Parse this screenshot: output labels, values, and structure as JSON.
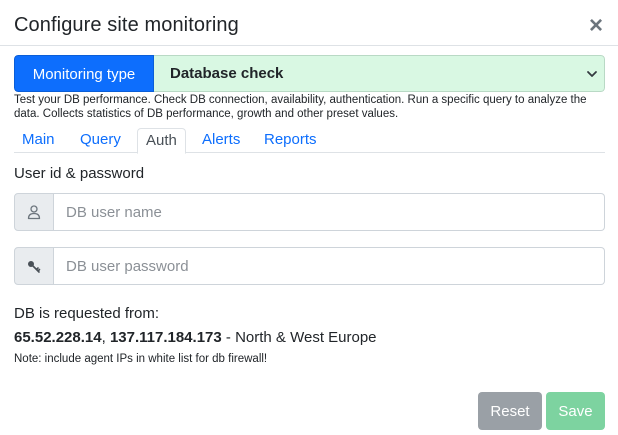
{
  "dialog": {
    "title": "Configure site monitoring",
    "close_symbol": "×"
  },
  "monitoring_type": {
    "label": "Monitoring type",
    "selected": "Database check",
    "icon": "chevron-down-icon"
  },
  "description": "Test your DB performance. Check DB connection, availability, authentication. Run a specific query to analyze the data. Collects statistics of DB performance, growth and other preset values.",
  "tabs": [
    {
      "label": "Main",
      "active": false
    },
    {
      "label": "Query",
      "active": false
    },
    {
      "label": "Auth",
      "active": true
    },
    {
      "label": "Alerts",
      "active": false
    },
    {
      "label": "Reports",
      "active": false
    }
  ],
  "auth": {
    "section_label": "User id & password",
    "username": {
      "placeholder": "DB user name",
      "value": "",
      "icon": "user-icon"
    },
    "password": {
      "placeholder": "DB user password",
      "value": "",
      "icon": "key-icon"
    }
  },
  "requested_from": {
    "label": "DB is requested from:",
    "ip1": "65.52.228.14",
    "separator": ", ",
    "ip2": "137.117.184.173",
    "region": " - North & West Europe",
    "note": "Note: include agent IPs in white list for db firewall!"
  },
  "buttons": {
    "reset": "Reset",
    "save": "Save"
  },
  "colors": {
    "primary": "#0d6efd",
    "select_bg": "#d9f8e3",
    "reset_bg": "#9aa0a6",
    "save_bg": "#7dd3a0"
  }
}
